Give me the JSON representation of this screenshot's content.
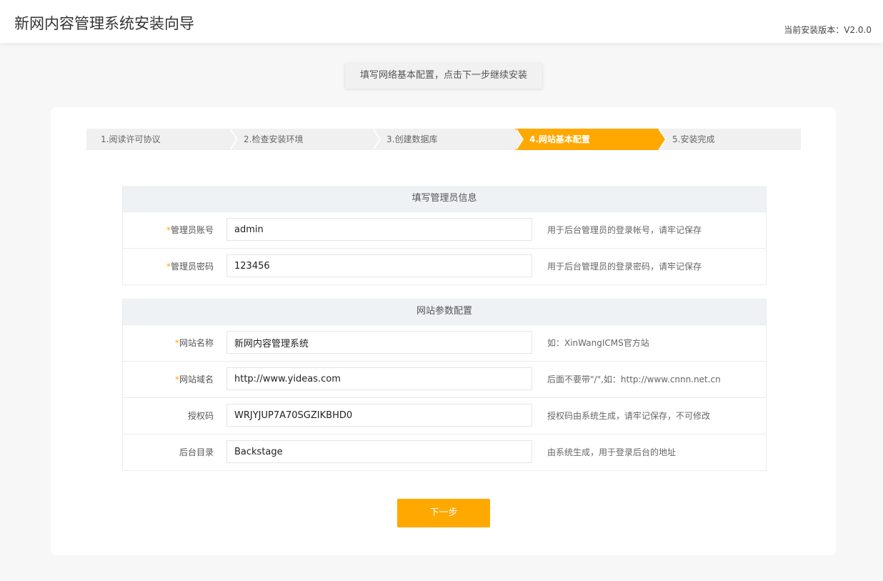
{
  "header": {
    "title": "新网内容管理系统安装向导",
    "version": "当前安装版本：V2.0.0"
  },
  "tip": "填写网络基本配置，点击下一步继续安装",
  "steps": [
    {
      "label": "1.阅读许可协议",
      "active": false
    },
    {
      "label": "2.检查安装环境",
      "active": false
    },
    {
      "label": "3.创建数据库",
      "active": false
    },
    {
      "label": "4.网站基本配置",
      "active": true
    },
    {
      "label": "5.安装完成",
      "active": false
    }
  ],
  "admin_section": {
    "title": "填写管理员信息",
    "fields": [
      {
        "required_mark": "*",
        "label": "管理员账号",
        "value": "admin",
        "hint": "用于后台管理员的登录帐号，请牢记保存"
      },
      {
        "required_mark": "*",
        "label": "管理员密码",
        "value": "123456",
        "hint": "用于后台管理员的登录密码，请牢记保存"
      }
    ]
  },
  "site_section": {
    "title": "网站参数配置",
    "fields": [
      {
        "required_mark": "*",
        "label": "网站名称",
        "value": "新网内容管理系统",
        "hint": "如：XinWangICMS官方站"
      },
      {
        "required_mark": "*",
        "label": "网站域名",
        "value": "http://www.yideas.com",
        "hint": "后面不要带\"/\",如：http://www.cnnn.net.cn"
      },
      {
        "required_mark": "",
        "label": "授权码",
        "value": "WRJYJUP7A70SGZIKBHD0",
        "hint": "授权码由系统生成，请牢记保存，不可修改"
      },
      {
        "required_mark": "",
        "label": "后台目录",
        "value": "Backstage",
        "hint": "由系统生成，用于登录后台的地址"
      }
    ]
  },
  "next_button": "下一步",
  "colors": {
    "accent": "#ffa800",
    "background": "#f7f7f7",
    "section_head": "#eef2f5"
  }
}
